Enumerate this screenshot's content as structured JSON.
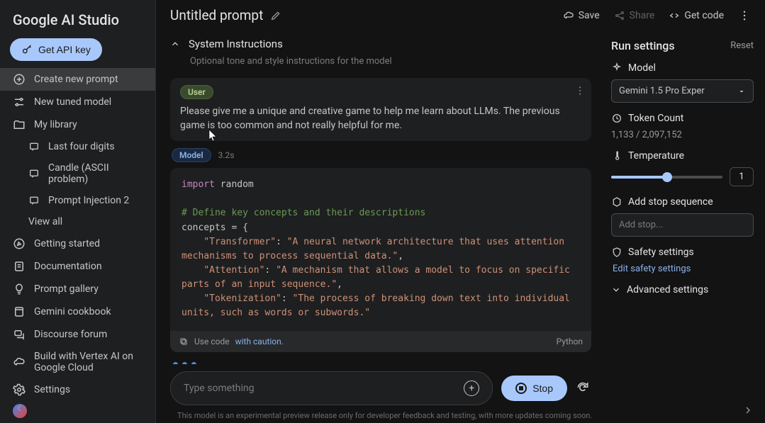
{
  "app": {
    "name": "Google AI Studio"
  },
  "sidebar": {
    "api_key": "Get API key",
    "create_prompt": "Create new prompt",
    "tuned_model": "New tuned model",
    "my_library": "My library",
    "library_items": [
      {
        "label": "Last four digits"
      },
      {
        "label": "Candle (ASCII problem)"
      },
      {
        "label": "Prompt Injection 2"
      }
    ],
    "view_all": "View all",
    "getting_started": "Getting started",
    "documentation": "Documentation",
    "prompt_gallery": "Prompt gallery",
    "cookbook": "Gemini cookbook",
    "forum": "Discourse forum",
    "vertex": "Build with Vertex AI on Google Cloud",
    "settings": "Settings"
  },
  "header": {
    "title": "Untitled prompt",
    "save": "Save",
    "share": "Share",
    "get_code": "Get code"
  },
  "system": {
    "title": "System Instructions",
    "subtitle": "Optional tone and style instructions for the model"
  },
  "chat": {
    "user_label": "User",
    "user_text": "Please give me a unique and creative game to help me learn about LLMs. The previous game is too common and not really helpful for me.",
    "model_label": "Model",
    "latency": "3.2s",
    "code_kw": "import",
    "code_mod": " random",
    "code_comment": "# Define key concepts and their descriptions",
    "code_line1": "concepts = {",
    "code_k1": "\"Transformer\"",
    "code_v1": "\"A neural network architecture that uses attention mechanisms to process sequential data.\"",
    "code_k2": "\"Attention\"",
    "code_v2": "\"A mechanism that allows a model to focus on specific parts of an input sequence.\"",
    "code_k3": "\"Tokenization\"",
    "code_v3": "\"The process of breaking down text into individual units, such as words or subwords.\"",
    "caution_prefix": "Use code ",
    "caution_link": "with caution.",
    "code_lang": "Python",
    "input_placeholder": "Type something",
    "stop_label": "Stop",
    "disclaimer": "This model is an experimental preview release only for developer feedback and testing, with more updates coming soon."
  },
  "run": {
    "title": "Run settings",
    "reset": "Reset",
    "model_label": "Model",
    "model_value": "Gemini 1.5 Pro Exper",
    "token_label": "Token Count",
    "token_value": "1,133 / 2,097,152",
    "temp_label": "Temperature",
    "temp_value": "1",
    "stop_label": "Add stop sequence",
    "stop_placeholder": "Add stop...",
    "safety_label": "Safety settings",
    "safety_link": "Edit safety settings",
    "advanced": "Advanced settings"
  }
}
